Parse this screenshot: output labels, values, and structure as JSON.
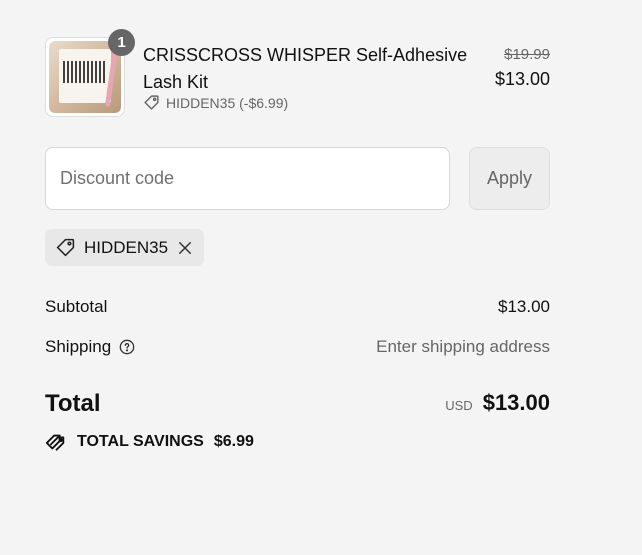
{
  "cart_item": {
    "quantity": "1",
    "title": "CRISSCROSS WHISPER Self-Adhesive Lash Kit",
    "discount_text": "HIDDEN35 (-$6.99)",
    "original_price": "$19.99",
    "price": "$13.00",
    "thumbnail_icon": "lash-kit-product-image"
  },
  "discount": {
    "placeholder": "Discount code",
    "apply_label": "Apply",
    "applied_code": "HIDDEN35"
  },
  "summary": {
    "subtotal_label": "Subtotal",
    "subtotal_value": "$13.00",
    "shipping_label": "Shipping",
    "shipping_value": "Enter shipping address",
    "total_label": "Total",
    "currency": "USD",
    "total_value": "$13.00",
    "savings_label": "TOTAL SAVINGS",
    "savings_value": "$6.99"
  },
  "colors": {
    "background": "#f4f4f4",
    "muted_text": "#666666",
    "chip_bg": "#e8e8e8"
  }
}
